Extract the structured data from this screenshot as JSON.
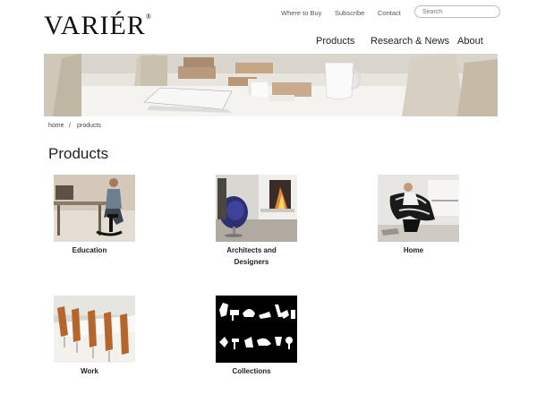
{
  "header": {
    "logo": "VARIÉR",
    "logo_mark": "®",
    "util_links": [
      "Where to Buy",
      "Subscribe",
      "Contact"
    ],
    "search_placeholder": "Search",
    "main_nav": [
      "Products",
      "Research & News",
      "About"
    ]
  },
  "breadcrumb": {
    "home": "home",
    "separator": "/",
    "current": "products"
  },
  "page_title": "Products",
  "products": [
    {
      "label_line1": "Education",
      "label_line2": ""
    },
    {
      "label_line1": "Architects and",
      "label_line2": "Designers"
    },
    {
      "label_line1": "Home",
      "label_line2": ""
    },
    {
      "label_line1": "Work",
      "label_line2": ""
    },
    {
      "label_line1": "Collections",
      "label_line2": ""
    }
  ]
}
